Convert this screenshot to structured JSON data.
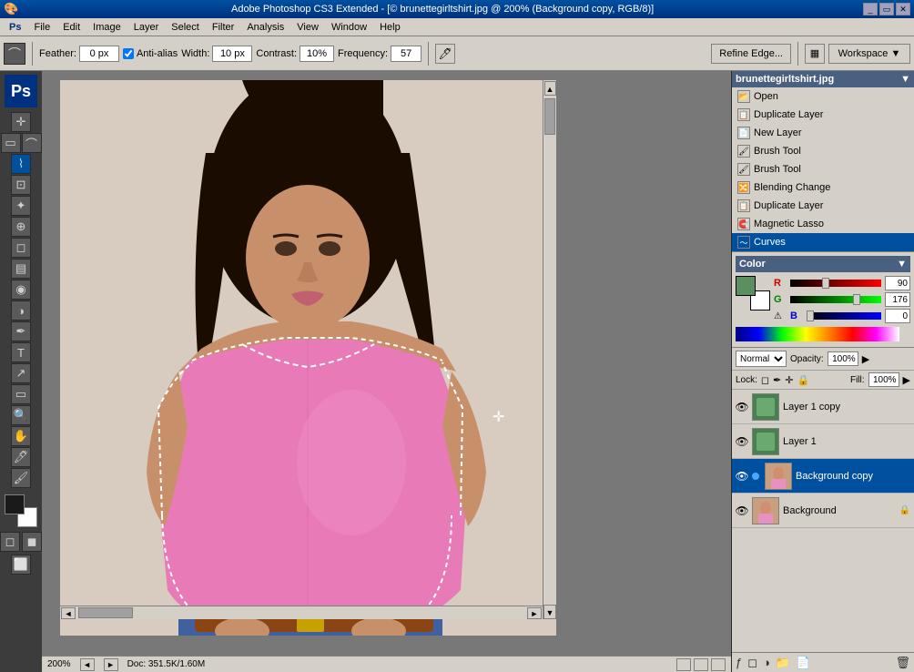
{
  "titlebar": {
    "title": "Adobe Photoshop CS3 Extended - [© brunettegirltshirt.jpg @ 200% (Background copy, RGB/8)]",
    "controls": [
      "minimize",
      "restore",
      "close"
    ]
  },
  "menubar": {
    "items": [
      "Ps",
      "File",
      "Edit",
      "Image",
      "Layer",
      "Select",
      "Filter",
      "Analysis",
      "View",
      "Window",
      "Help"
    ]
  },
  "toolbar": {
    "feather_label": "Feather:",
    "feather_value": "0 px",
    "antialias_label": "Anti-alias",
    "width_label": "Width:",
    "width_value": "10 px",
    "contrast_label": "Contrast:",
    "contrast_value": "10%",
    "frequency_label": "Frequency:",
    "frequency_value": "57",
    "refine_btn": "Refine Edge...",
    "workspace_btn": "Workspace ▼"
  },
  "history_panel": {
    "title": "brunettegirltshirt.jpg",
    "items": [
      {
        "label": "Open",
        "icon": "📂"
      },
      {
        "label": "Duplicate Layer",
        "icon": "📋"
      },
      {
        "label": "New Layer",
        "icon": "📄"
      },
      {
        "label": "Brush Tool",
        "icon": "🖌"
      },
      {
        "label": "Brush Tool",
        "icon": "🖌"
      },
      {
        "label": "Blending Change",
        "icon": "🔀"
      },
      {
        "label": "Duplicate Layer",
        "icon": "📋"
      },
      {
        "label": "Magnetic Lasso",
        "icon": "🧲"
      },
      {
        "label": "Curves",
        "icon": "〜",
        "selected": true
      }
    ]
  },
  "color_panel": {
    "swatch_fg": "#1a1a1a",
    "swatch_bg": "#ffffff",
    "r_label": "R",
    "r_value": "90",
    "g_label": "G",
    "g_value": "176",
    "b_label": "B",
    "b_value": "0",
    "warning": "⚠"
  },
  "layers_panel": {
    "blend_mode": "Normal",
    "opacity_label": "Opacity:",
    "opacity_value": "100%",
    "fill_label": "Fill:",
    "fill_value": "100%",
    "lock_label": "Lock:",
    "layers": [
      {
        "name": "Layer 1 copy",
        "visible": true,
        "thumb_color": "green",
        "locked": false,
        "selected": false
      },
      {
        "name": "Layer 1",
        "visible": true,
        "thumb_color": "green",
        "locked": false,
        "selected": false
      },
      {
        "name": "Background copy",
        "visible": true,
        "thumb_color": "photo",
        "locked": false,
        "selected": true
      },
      {
        "name": "Background",
        "visible": true,
        "thumb_color": "photo",
        "locked": true,
        "selected": false
      }
    ]
  },
  "statusbar": {
    "zoom": "200%",
    "doc_info": "Doc: 351.5K/1.60M"
  },
  "canvas": {
    "bg_color": "#c0c0c0"
  }
}
